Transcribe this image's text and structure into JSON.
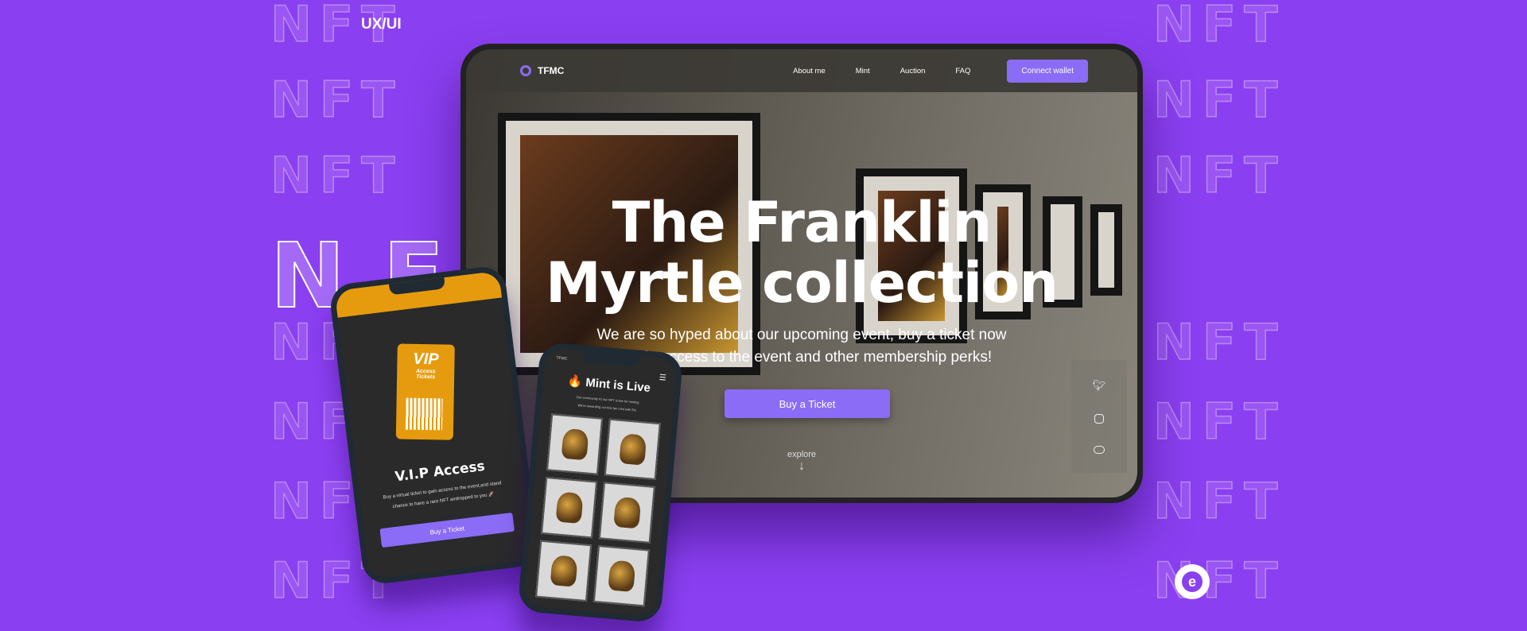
{
  "background": {
    "label": "UX/UI",
    "watermark": "NFT",
    "accent": "#8a3ff0"
  },
  "desktop": {
    "logo": "TFMC",
    "nav": [
      "About me",
      "Mint",
      "Auction",
      "FAQ"
    ],
    "connect_wallet": "Connect wallet",
    "title_line1": "The Franklin",
    "title_line2": "Myrtle collection",
    "subtitle_line1": "We are so hyped about our upcoming event, buy a ticket now",
    "subtitle_line2": "to gain access to the event and other membership perks!",
    "cta": "Buy a Ticket",
    "explore": "explore",
    "explore_arrow": "↓",
    "social": [
      "twitter-icon",
      "instagram-icon",
      "discord-icon"
    ],
    "button_color": "#8b6cf6"
  },
  "phone_vip": {
    "ticket_title": "VIP",
    "ticket_line1": "Access",
    "ticket_line2": "Tickets",
    "heading": "V.I.P Access",
    "text": "Buy a virtual ticket to gain access to the event,and stand chance to have a rare NFT airdropped to you 🚀",
    "cta": "Buy a Ticket"
  },
  "phone_mint": {
    "logo": "TFMC",
    "heading": "🔥 Mint is Live",
    "text_line1": "Our community #1 tier NFT is live for minting",
    "text_line2": "We're rewarding our first tier mint with 5%",
    "menu_icon": "☰"
  }
}
